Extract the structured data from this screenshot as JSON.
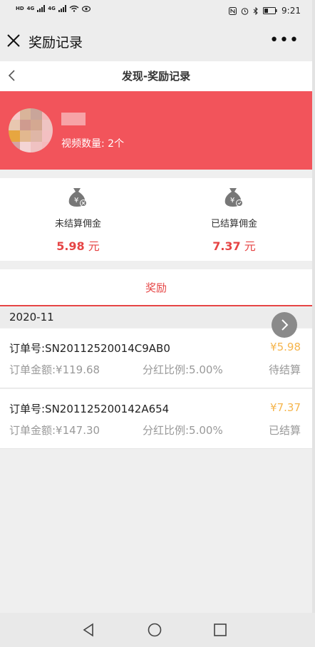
{
  "status_bar": {
    "left_labels": [
      "HD",
      "4G",
      "4G"
    ],
    "time": "9:21",
    "battery_icon": "battery-icon"
  },
  "wechat_bar": {
    "title": "奖励记录",
    "more": "•••"
  },
  "page_nav": {
    "title": "发现-奖励记录"
  },
  "profile": {
    "video_count": "视频数量: 2个"
  },
  "commission": {
    "unsettled": {
      "label": "未结算佣金",
      "amount": "5.98",
      "unit": "元"
    },
    "settled": {
      "label": "已结算佣金",
      "amount": "7.37",
      "unit": "元"
    }
  },
  "tabs": {
    "reward": "奖励"
  },
  "month": "2020-11",
  "orders": [
    {
      "order_no": "订单号:SN20112520014C9AB0",
      "price": "¥5.98",
      "amount": "订单金额:¥119.68",
      "ratio": "分红比例:5.00%",
      "status": "待结算"
    },
    {
      "order_no": "订单号:SN201125200142A654",
      "price": "¥7.37",
      "amount": "订单金额:¥147.30",
      "ratio": "分红比例:5.00%",
      "status": "已结算"
    }
  ],
  "colors": {
    "brand_red": "#f2545b",
    "accent_red": "#e64545",
    "price_orange": "#f5b54d"
  }
}
